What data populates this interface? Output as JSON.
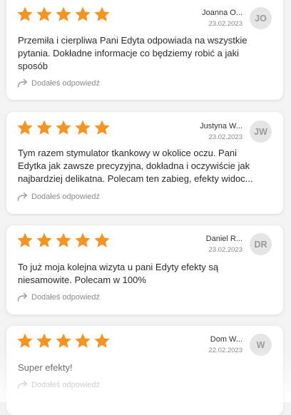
{
  "reviews": [
    {
      "stars": 5,
      "name": "Joanna O...",
      "date": "23.02.2023",
      "initials": "JO",
      "lines": [
        "Przemiła i cierpliwa Pani Edyta odpowiada na wszystkie",
        "pytania. Dokładne informacje co będziemy robić a jaki",
        "sposób"
      ],
      "reply_label": "Dodałeś odpowiedź"
    },
    {
      "stars": 5,
      "name": "Justyna W...",
      "date": "23.02.2023",
      "initials": "JW",
      "lines": [
        "Tym razem stymulator tkankowy w okolice oczu. Pani",
        "Edytka jak zawsze precyzyjna, dokładna i  oczywiście jak",
        "najbardziej delikatna. Polecam ten zabieg, efekty widoc..."
      ],
      "reply_label": "Dodałeś odpowiedź"
    },
    {
      "stars": 5,
      "name": "Daniel R...",
      "date": "23.02.2023",
      "initials": "DR",
      "lines": [
        "To już moja kolejna wizyta u pani Edyty efekty są",
        "niesamowite. Polecam w 100%"
      ],
      "reply_label": "Dodałeś odpowiedź"
    },
    {
      "stars": 5,
      "name": "Dom W...",
      "date": "22.02.2023",
      "initials": "W",
      "lines": [
        "Super efekty!"
      ],
      "reply_label": "Dodałeś odpowiedź"
    }
  ],
  "colors": {
    "star": "#f39423",
    "avatar_bg": "#e5e5e5",
    "avatar_text": "#9a9a9a"
  }
}
